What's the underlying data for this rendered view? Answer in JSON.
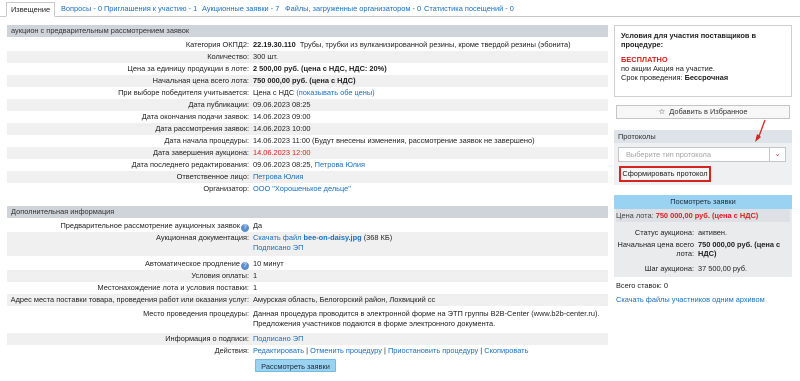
{
  "tabs": [
    {
      "label": "Извещение"
    },
    {
      "label": "Вопросы - 0"
    },
    {
      "label": "Приглашения к участию - 1"
    },
    {
      "label": "Аукционные заявки - 7"
    },
    {
      "label": "Файлы, загруженные организатором - 0"
    },
    {
      "label": "Статистика посещений - 0"
    }
  ],
  "section1": "аукцион с предварительным рассмотрением заявок",
  "okpd": {
    "label": "Категория ОКПД2:",
    "code": "22.19.30.110",
    "text": "Трубы, трубки из вулканизированной резины, кроме твердой резины (эбонита)"
  },
  "rows1": [
    {
      "label": "Количество:",
      "value": "300 шт."
    },
    {
      "label": "Цена за единицу продукции в лоте:",
      "value": "2 500,00 руб. (цена с НДС, НДС: 20%)"
    },
    {
      "label": "Начальная цена всего лота:",
      "value": "750 000,00 руб. (цена с НДС)"
    }
  ],
  "winner": {
    "label": "При выборе победителя учитывается:",
    "value": "Цена с НДС",
    "link": "(показывать обе цены)"
  },
  "rows2": [
    {
      "label": "Дата публикации:",
      "value": "09.06.2023 08:25"
    },
    {
      "label": "Дата окончания подачи заявок:",
      "value": "14.06.2023 09:00"
    },
    {
      "label": "Дата рассмотрения заявок:",
      "value": "14.06.2023 10:00"
    },
    {
      "label": "Дата начала процедуры:",
      "value": "14.06.2023 11:00 (Будут внесены изменения, рассмотрение заявок не завершено)"
    }
  ],
  "end": {
    "label": "Дата завершения аукциона:",
    "value": "14.06.2023 12:00"
  },
  "lastedit": {
    "label": "Дата последнего редактирования:",
    "value": "09.06.2023 08:25,",
    "link": "Петрова Юлия"
  },
  "responsible": {
    "label": "Ответственное лицо:",
    "link": "Петрова Юлия"
  },
  "organizer": {
    "label": "Организатор:",
    "link": "ООО \"Хорошенькое дельце\""
  },
  "section2": "Дополнительная информация",
  "prelim": {
    "label": "Предварительное рассмотрение аукционных заявок",
    "value": "Да"
  },
  "docs": {
    "label": "Аукционная документация:",
    "prefix": "Скачать файл",
    "file": "bee-on-daisy.jpg",
    "size": "(368 КБ)",
    "signed": "Подписано ЭП"
  },
  "autoext": {
    "label": "Автоматическое продление",
    "value": "10 минут"
  },
  "payment": {
    "label": "Условия оплаты:",
    "value": "1"
  },
  "location": {
    "label": "Местонахождение лота и условия поставки:",
    "value": "1"
  },
  "address": {
    "label": "Адрес места поставки товара, проведения работ или оказания услуг:",
    "value": "Амурская область, Белогорский район, Лохвицкий сс"
  },
  "venue": {
    "label": "Место проведения процедуры:",
    "line1": "Данная процедура проводится в электронной форме на ЭТП группы B2B-Center (www.b2b-center.ru).",
    "line2": "Предложения участников подаются в форме электронного документа."
  },
  "signinfo": {
    "label": "Информация о подписи:",
    "link": "Подписано ЭП"
  },
  "actions": {
    "label": "Действия:",
    "edit": "Редактировать",
    "cancel": "Отменить процедуру",
    "suspend": "Приостановить процедуру",
    "copy": "Скопировать",
    "sep": "|"
  },
  "review_button": "Рассмотреть заявки",
  "sidebar": {
    "cond_title": "Условия для участия поставщиков в процедуре:",
    "free": "БЕСПЛАТНО",
    "promo": "по акции Акция на участие.",
    "period_label": "Срок проведения:",
    "period_value": "Бессрочная",
    "favorite": "Добавить в Избранное",
    "protocols_title": "Протоколы",
    "protocol_placeholder": "Выберите тип протокола",
    "generate": "Сформировать протокол",
    "view_bids": "Посмотреть заявки",
    "price_label": "Цена лота:",
    "price_value": "750 000,00 руб. (цена с НДС)",
    "status_label": "Статус аукциона:",
    "status_value": "активен.",
    "start_price_label": "Начальная цена всего лота:",
    "start_price_value": "750 000,00 руб. (цена с НДС)",
    "step_label": "Шаг аукциона:",
    "step_value": "37 500,00 руб.",
    "bids_total": "Всего ставок: 0",
    "download_files": "Скачать файлы участников одним архивом"
  },
  "colors": {
    "accent": "#1a6fc0",
    "danger": "#d9201c",
    "button": "#9ad3f1"
  }
}
